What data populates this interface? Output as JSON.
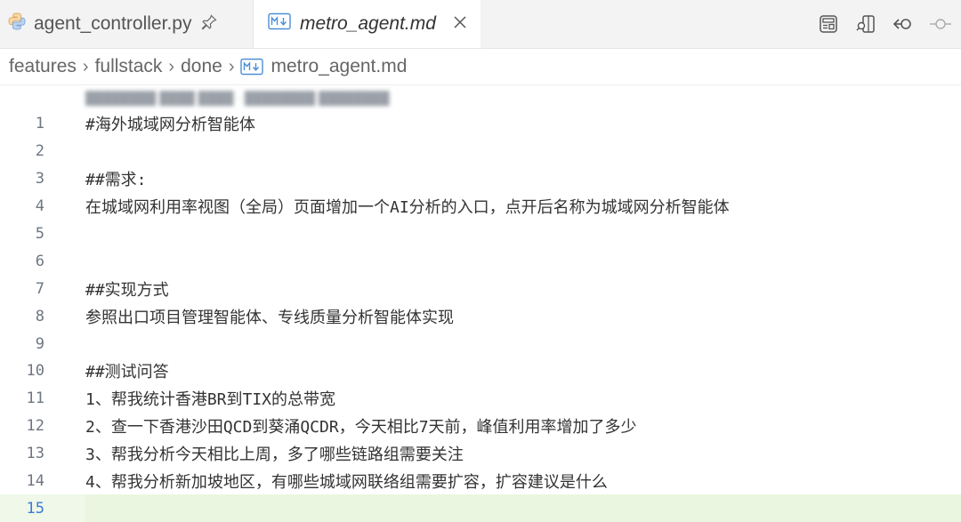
{
  "tabs": [
    {
      "label": "agent_controller.py",
      "icon": "python-icon",
      "pinned": true
    },
    {
      "label": "metro_agent.md",
      "icon": "markdown-icon",
      "active": true
    }
  ],
  "toolbar": {
    "icons": [
      "open-preview-icon",
      "open-preview-side-icon",
      "go-back-icon",
      "timeline-icon"
    ]
  },
  "breadcrumb": [
    "features",
    "fullstack",
    "done",
    "metro_agent.md"
  ],
  "editor": {
    "lines": [
      {
        "n": "1",
        "text": "#海外城域网分析智能体"
      },
      {
        "n": "2",
        "text": ""
      },
      {
        "n": "3",
        "text": "##需求:"
      },
      {
        "n": "4",
        "text": "在城域网利用率视图（全局）页面增加一个AI分析的入口，点开后名称为城域网分析智能体"
      },
      {
        "n": "5",
        "text": ""
      },
      {
        "n": "6",
        "text": ""
      },
      {
        "n": "7",
        "text": "##实现方式"
      },
      {
        "n": "8",
        "text": "参照出口项目管理智能体、专线质量分析智能体实现"
      },
      {
        "n": "9",
        "text": ""
      },
      {
        "n": "10",
        "text": "##测试问答"
      },
      {
        "n": "11",
        "text": "1、帮我统计香港BR到TIX的总带宽"
      },
      {
        "n": "12",
        "text": "2、查一下香港沙田QCD到葵涌QCDR，今天相比7天前，峰值利用率增加了多少"
      },
      {
        "n": "13",
        "text": "3、帮我分析今天相比上周，多了哪些链路组需要关注"
      },
      {
        "n": "14",
        "text": "4、帮我分析新加坡地区，有哪些城域网联络组需要扩容，扩容建议是什么"
      },
      {
        "n": "15",
        "text": ""
      }
    ],
    "current_line": 15
  },
  "colors": {
    "tabbar_bg": "#f3f3f3",
    "current_line_bg": "#eaf6df",
    "current_line_number": "#3a7bd5",
    "markdown_icon": "#4a8fd6"
  }
}
